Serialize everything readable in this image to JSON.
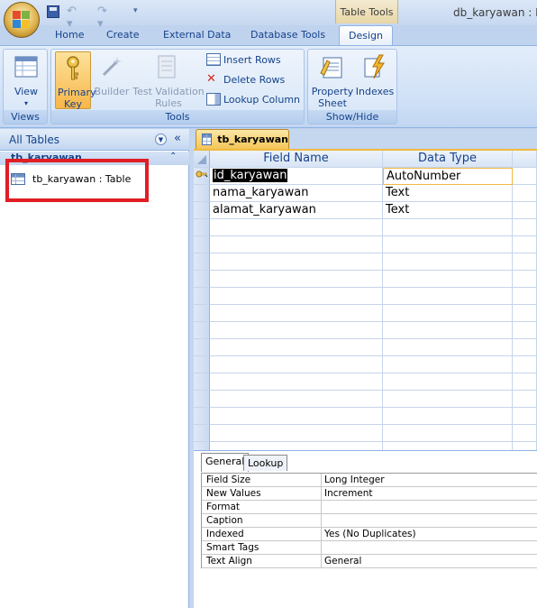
{
  "window": {
    "title": "db_karyawan : Dat",
    "context_tab_group": "Table Tools"
  },
  "tabs": [
    {
      "label": "Home"
    },
    {
      "label": "Create"
    },
    {
      "label": "External Data"
    },
    {
      "label": "Database Tools"
    },
    {
      "label": "Design",
      "active": true
    }
  ],
  "ribbon": {
    "views": {
      "label": "Views",
      "view_button": "View"
    },
    "tools": {
      "label": "Tools",
      "primary_key": "Primary Key",
      "builder": "Builder",
      "test_validation_rules": "Test Validation Rules",
      "insert_rows": "Insert Rows",
      "delete_rows": "Delete Rows",
      "lookup_column": "Lookup Column"
    },
    "show_hide": {
      "label": "Show/Hide",
      "property_sheet": "Property Sheet",
      "indexes": "Indexes"
    }
  },
  "nav": {
    "title": "All Tables",
    "group_label": "tb_karyawan",
    "items": [
      {
        "label": "tb_karyawan : Table"
      }
    ]
  },
  "document": {
    "tab_label": "tb_karyawan",
    "columns": {
      "field_name": "Field Name",
      "data_type": "Data Type"
    },
    "rows": [
      {
        "field": "id_karyawan",
        "type": "AutoNumber",
        "primary_key": true,
        "selected": true
      },
      {
        "field": "nama_karyawan",
        "type": "Text"
      },
      {
        "field": "alamat_karyawan",
        "type": "Text"
      }
    ]
  },
  "field_properties": {
    "tabs": [
      {
        "label": "General",
        "active": true
      },
      {
        "label": "Lookup"
      }
    ],
    "rows": [
      {
        "key": "Field Size",
        "value": "Long Integer"
      },
      {
        "key": "New Values",
        "value": "Increment"
      },
      {
        "key": "Format",
        "value": ""
      },
      {
        "key": "Caption",
        "value": ""
      },
      {
        "key": "Indexed",
        "value": "Yes (No Duplicates)"
      },
      {
        "key": "Smart Tags",
        "value": ""
      },
      {
        "key": "Text Align",
        "value": "General"
      }
    ]
  },
  "colors": {
    "accent_blue": "#15428b",
    "highlight_red": "#e01e24",
    "active_tab_orange": "#f4c658"
  }
}
